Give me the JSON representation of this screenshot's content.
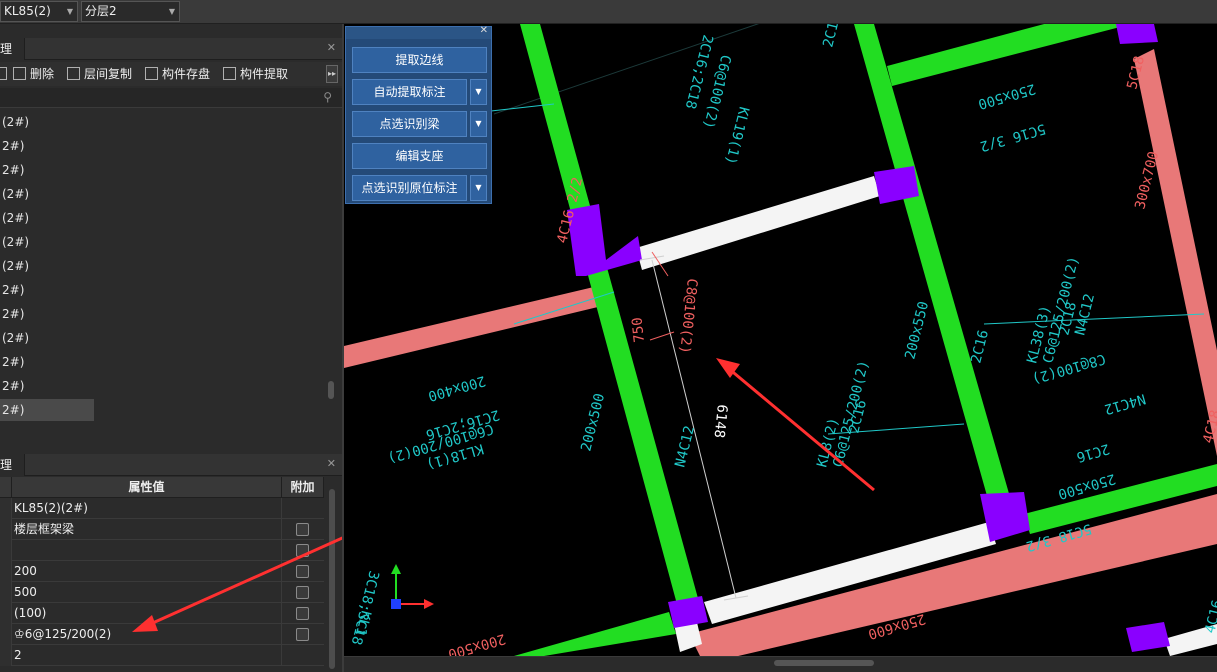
{
  "topbar": {
    "component_select": "KL85(2)(2#)",
    "layer_select": "分层2"
  },
  "component_panel": {
    "title": "理",
    "toolbar": {
      "delete_label": "删除",
      "copy_floor_label": "层间复制",
      "save_label": "构件存盘",
      "extract_label": "构件提取"
    },
    "items": [
      "(2#)",
      "2#)",
      "2#)",
      "(2#)",
      "(2#)",
      "(2#)",
      "(2#)",
      "2#)",
      "2#)",
      "(2#)",
      "2#)",
      "2#)",
      "2#)"
    ],
    "selected_index": 12
  },
  "property_panel": {
    "title": "理",
    "header_value": "属性值",
    "header_extra": "附加",
    "rows": [
      {
        "value": "KL85(2)(2#)",
        "has_check": false
      },
      {
        "value": "楼层框架梁",
        "has_check": true
      },
      {
        "value": "",
        "has_check": true
      },
      {
        "value": "200",
        "has_check": true
      },
      {
        "value": "500",
        "has_check": true
      },
      {
        "value": "(100)",
        "has_check": true
      },
      {
        "value": "♔6@125/200(2)",
        "has_check": true
      },
      {
        "value": "2",
        "has_check": false
      }
    ]
  },
  "float_panel": {
    "btn_extract_lines": "提取边线",
    "btn_auto_extract": "自动提取标注",
    "btn_pick_beam": "点选识别梁",
    "btn_edit_support": "编辑支座",
    "btn_pick_origin": "点选识别原位标注"
  },
  "cad": {
    "dim_750": "750",
    "dim_6148": "6148",
    "txt_c8_100": "C8@100(2)",
    "txt_200x500_a": "200x500",
    "txt_200x500_b": "200x500",
    "txt_200x400": "200x400",
    "txt_250x600": "250x600",
    "txt_300x700": "300x700",
    "txt_200x550": "200x550",
    "txt_250x500_a": "250x500",
    "txt_250x500_b": "250x500",
    "txt_n4c12": "N4C12",
    "txt_n4c12_b": "N4C12",
    "txt_4c16": "4C16 2/2",
    "txt_5c16": "5C16 3/2",
    "txt_5c18": "5C18 3/2",
    "txt_5c18_b": "5C18",
    "txt_4c18": "4C18",
    "txt_4c16_b": "4C16",
    "txt_2c16": "2C16",
    "txt_2c16_b": "2C16",
    "txt_kl18": "KL18(1)",
    "txt_kl18_b": "C6@100/200(2)",
    "txt_kl18_c": "2C16;2C16",
    "txt_kl38": "KL38(3)",
    "txt_kl38_b": "C6@125/200(2)",
    "txt_kl38_c": "2C18",
    "txt_kl38_d": "N4C12",
    "txt_kl8": "KL8(2)",
    "txt_kl8_b": "C6@125/200(2)",
    "txt_kl8_c": "2C16",
    "txt_kl19": "KL19(1)",
    "txt_kl19_b": "C6@100(2)",
    "txt_kl19_c": "2C16;2C18",
    "txt_c8_100b": "C8@100(2)",
    "txt_c16": "2C16",
    "txt_kl_small": "KL1",
    "txt_3c18": "3C18;3C18"
  },
  "colors": {
    "green_beam": "#22dd22",
    "white_beam": "#f4f4f4",
    "pink_beam": "#e87878",
    "purple_column": "#8a00ff",
    "cyan_text": "#20c8c8",
    "red_text": "#f06060",
    "red_arrow": "#ff3030"
  }
}
